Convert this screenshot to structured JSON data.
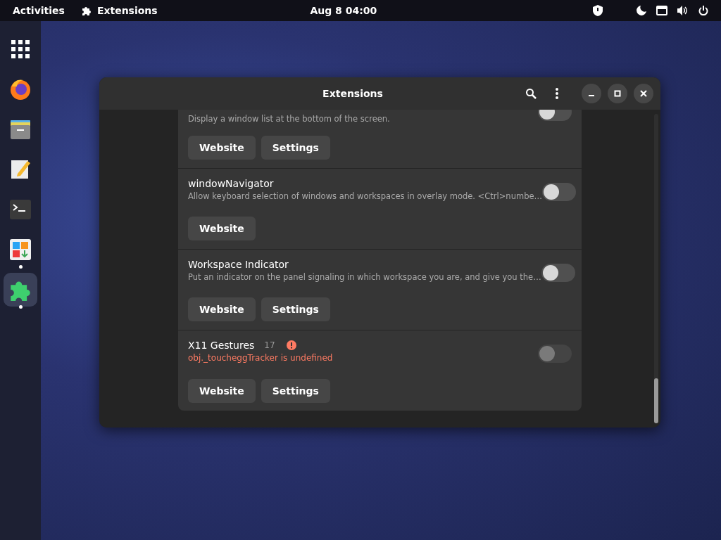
{
  "top_bar": {
    "activities": "Activities",
    "app_menu": "Extensions",
    "clock": "Aug 8  04:00"
  },
  "dock": [
    {
      "kind": "grid",
      "running": false,
      "selected": false
    },
    {
      "kind": "browser",
      "running": false,
      "selected": false
    },
    {
      "kind": "files",
      "running": false,
      "selected": false
    },
    {
      "kind": "editor",
      "running": false,
      "selected": false
    },
    {
      "kind": "terminal",
      "running": false,
      "selected": false
    },
    {
      "kind": "software",
      "running": true,
      "selected": false
    },
    {
      "kind": "extensions",
      "running": true,
      "selected": true
    }
  ],
  "window": {
    "title": "Extensions"
  },
  "extensions": [
    {
      "description": "Display a window list at the bottom of the screen.",
      "on": false,
      "disabled": false,
      "buttons": [
        "Website",
        "Settings"
      ]
    },
    {
      "name": "windowNavigator",
      "description": "Allow keyboard selection of windows and workspaces in overlay mode. <Ctrl>numbe…",
      "on": false,
      "disabled": false,
      "buttons": [
        "Website"
      ]
    },
    {
      "name": "Workspace Indicator",
      "description": "Put an indicator on the panel signaling in which workspace you are, and give you the…",
      "on": false,
      "disabled": false,
      "buttons": [
        "Website",
        "Settings"
      ]
    },
    {
      "name": "X11 Gestures",
      "version": "17",
      "error": "obj._toucheggTracker is undefined",
      "on": false,
      "disabled": true,
      "buttons": [
        "Website",
        "Settings"
      ]
    }
  ]
}
